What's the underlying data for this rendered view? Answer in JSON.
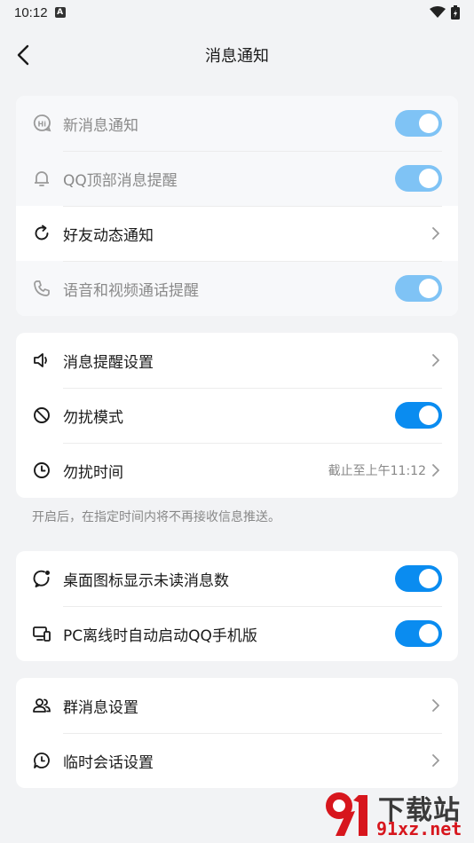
{
  "status": {
    "time": "10:12"
  },
  "header": {
    "title": "消息通知"
  },
  "group1": [
    {
      "label": "新消息通知",
      "icon": "hi-bubble-icon",
      "control": "toggle",
      "disabled": true
    },
    {
      "label": "QQ顶部消息提醒",
      "icon": "bell-icon",
      "control": "toggle",
      "disabled": true
    },
    {
      "label": "好友动态通知",
      "icon": "refresh-icon",
      "control": "chevron"
    },
    {
      "label": "语音和视频通话提醒",
      "icon": "phone-icon",
      "control": "toggle",
      "disabled": true
    }
  ],
  "group2": [
    {
      "label": "消息提醒设置",
      "icon": "speaker-icon",
      "control": "chevron"
    },
    {
      "label": "勿扰模式",
      "icon": "no-disturb-icon",
      "control": "toggle"
    },
    {
      "label": "勿扰时间",
      "icon": "clock-icon",
      "control": "chevron",
      "value": "截止至上午11:12"
    }
  ],
  "hint": "开启后，在指定时间内将不再接收信息推送。",
  "group3": [
    {
      "label": "桌面图标显示未读消息数",
      "icon": "badge-bubble-icon",
      "control": "toggle"
    },
    {
      "label": "PC离线时自动启动QQ手机版",
      "icon": "devices-icon",
      "control": "toggle"
    }
  ],
  "group4": [
    {
      "label": "群消息设置",
      "icon": "group-icon",
      "control": "chevron"
    },
    {
      "label": "临时会话设置",
      "icon": "temp-chat-icon",
      "control": "chevron"
    }
  ],
  "watermark": {
    "text": "下载站",
    "url": "91xz.net"
  },
  "colors": {
    "accent": "#0a8cf0",
    "accent_disabled": "#7fc3f5",
    "background": "#f2f3f5"
  }
}
